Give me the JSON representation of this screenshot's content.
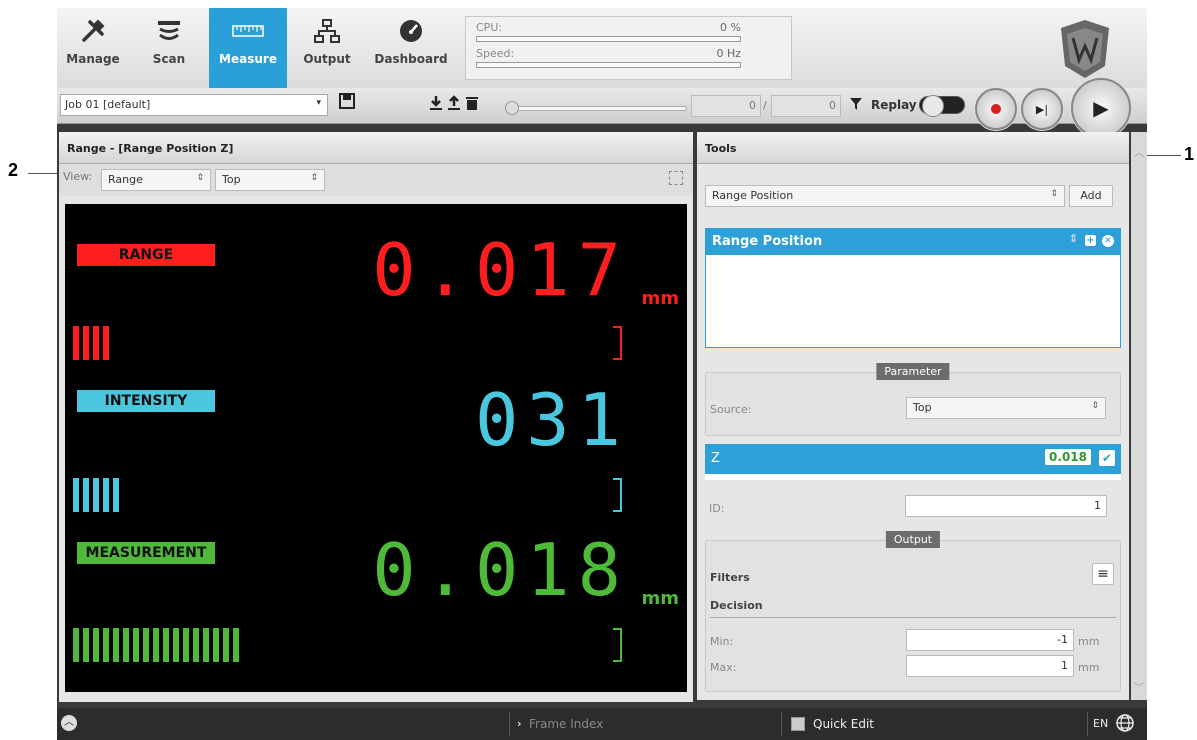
{
  "callouts": {
    "one": "1",
    "two": "2"
  },
  "nav": {
    "items": [
      {
        "label": "Manage",
        "icon": "wrench-icon"
      },
      {
        "label": "Scan",
        "icon": "scan-icon"
      },
      {
        "label": "Measure",
        "icon": "ruler-icon",
        "active": true
      },
      {
        "label": "Output",
        "icon": "network-icon"
      },
      {
        "label": "Dashboard",
        "icon": "gauge-icon"
      }
    ]
  },
  "metrics": {
    "cpu": {
      "label": "CPU:",
      "value": "0 %",
      "fraction": 0
    },
    "speed": {
      "label": "Speed:",
      "value": "0 Hz",
      "fraction": 0
    }
  },
  "toolbar": {
    "job": "Job 01 [default]",
    "frame_current": "0",
    "frame_sep": "/",
    "frame_total": "0",
    "replay_label": "Replay",
    "replay_on": false
  },
  "left_panel": {
    "title": "Range - [Range Position Z]",
    "view_label": "View:",
    "view_mode": "Range",
    "view_source": "Top"
  },
  "display": {
    "range": {
      "tag": "RANGE",
      "value": "0.017",
      "unit": "mm",
      "bars": 4,
      "color": "#ff1e1e"
    },
    "intensity": {
      "tag": "INTENSITY",
      "value": "031",
      "bars": 5,
      "color": "#4bc6df"
    },
    "measurement": {
      "tag": "MEASUREMENT",
      "value": "0.018",
      "unit": "mm",
      "bars": 17,
      "color": "#4fb93a"
    }
  },
  "tools": {
    "title": "Tools",
    "tool_select": "Range Position",
    "add_label": "Add",
    "tool_item": "Range Position",
    "parameter_legend": "Parameter",
    "source_label": "Source:",
    "source_value": "Top",
    "measurement_name": "Z",
    "measurement_value": "0.018",
    "id_label": "ID:",
    "id_value": "1",
    "output_legend": "Output",
    "filters_label": "Filters",
    "decision_label": "Decision",
    "min_label": "Min:",
    "min_value": "-1",
    "max_label": "Max:",
    "max_value": "1",
    "unit": "mm"
  },
  "status": {
    "frame_index": "Frame Index",
    "quick_edit": "Quick Edit",
    "language": "EN"
  }
}
